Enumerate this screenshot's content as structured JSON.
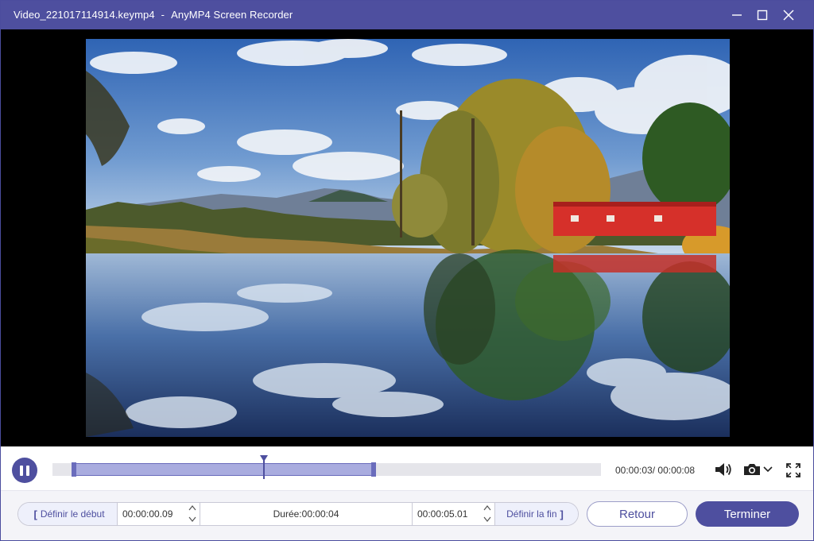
{
  "window": {
    "file_name": "Video_221017114914.keymp4",
    "separator": "-",
    "app_name": "AnyMP4 Screen Recorder",
    "controls": {
      "minimize": "minimize-icon",
      "maximize": "maximize-icon",
      "close": "close-icon"
    }
  },
  "colors": {
    "accent": "#4e4f9f",
    "selection": "#a9acdf",
    "track": "#e5e5ea"
  },
  "player": {
    "state": "playing",
    "play_button_icon": "pause-icon",
    "current_time": "00:00:03",
    "total_time": "00:00:08",
    "time_separator": "/ ",
    "selection_start_fraction": 0.037,
    "selection_end_fraction": 0.587,
    "playhead_fraction": 0.385,
    "icons": {
      "volume": "volume-icon",
      "snapshot": "camera-icon",
      "snapshot_menu": "chevron-down-icon",
      "fullscreen": "fullscreen-icon"
    }
  },
  "clip": {
    "set_start_label": "Définir le début",
    "start_value": "00:00:00.09",
    "duration_label": "Durée:",
    "duration_value": "00:00:04",
    "end_value": "00:00:05.01",
    "set_end_label": "Définir la fin",
    "bracket_open": "[",
    "bracket_close": "]"
  },
  "actions": {
    "back_label": "Retour",
    "finish_label": "Terminer"
  }
}
